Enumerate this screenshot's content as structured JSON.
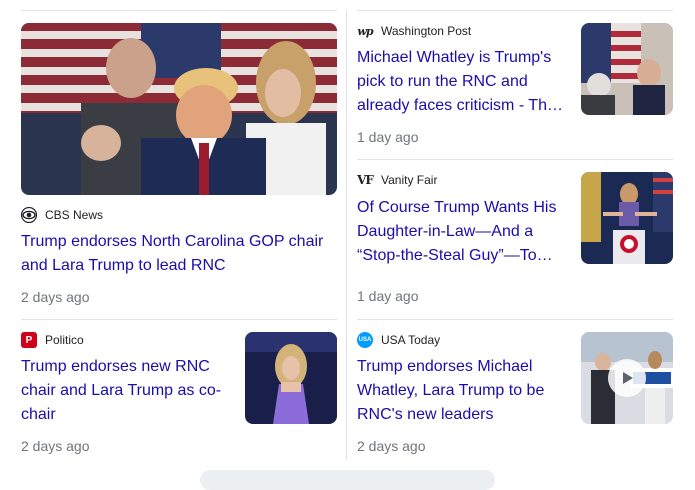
{
  "articles": [
    {
      "source": "CBS News",
      "source_icon": "cbs-eye-icon",
      "title": "Trump endorses North Carolina GOP chair and Lara Trump to lead RNC",
      "time": "2 days ago"
    },
    {
      "source": "Washington Post",
      "source_icon": "wp-logo-icon",
      "title": "Michael Whatley is Trump's pick to run the RNC and already faces criticism - The Washington Post",
      "time": "1 day ago"
    },
    {
      "source": "Vanity Fair",
      "source_icon": "vf-logo-icon",
      "title": "Of Course Trump Wants His Daughter-in-Law—And a “Stop-the-Steal Guy”—To Run the RNC",
      "time": "1 day ago"
    },
    {
      "source": "Politico",
      "source_icon": "politico-p-icon",
      "title": "Trump endorses new RNC chair and Lara Trump as co-chair",
      "time": "2 days ago"
    },
    {
      "source": "USA Today",
      "source_icon": "usa-today-icon",
      "title": "Trump endorses Michael Whatley, Lara Trump to be RNC's new leaders",
      "time": "2 days ago"
    }
  ],
  "colors": {
    "link": "#1a0dab",
    "meta": "#70757a",
    "politico": "#d0021b",
    "usatoday": "#009bff"
  }
}
